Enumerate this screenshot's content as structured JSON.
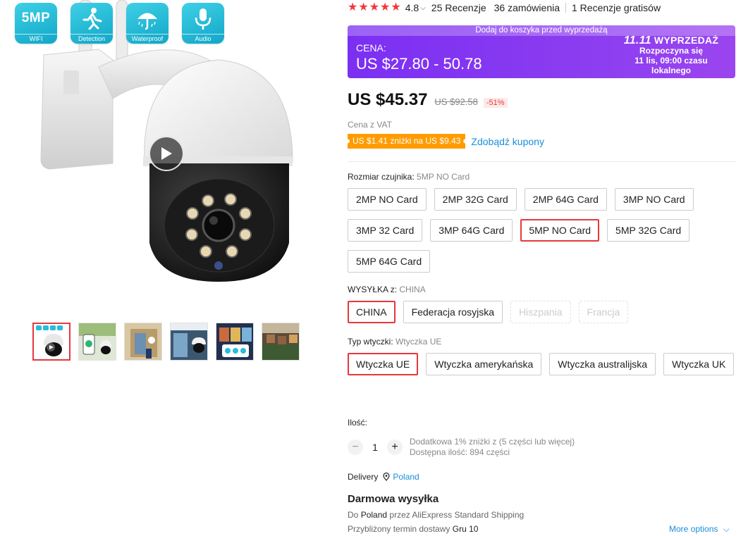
{
  "gallery": {
    "badges": [
      {
        "big": "5MP",
        "label": "WIFI"
      },
      {
        "icon": "running-person-icon",
        "label": "Detection"
      },
      {
        "icon": "umbrella-rain-icon",
        "label": "Waterproof"
      },
      {
        "icon": "microphone-icon",
        "label": "Audio"
      }
    ],
    "thumbnail_count": 6,
    "active_thumbnail": 1
  },
  "rating": {
    "stars": 5,
    "score": "4.8",
    "reviews": "25 Recenzje",
    "orders": "36 zamówienia",
    "gift_reviews": "1 Recenzje gratisów"
  },
  "promo": {
    "topbar": "Dodaj do koszyka przed wyprzedażą",
    "price_label": "CENA:",
    "price_range": "US $27.80 - 50.78",
    "sale_prefix": "11.11",
    "sale_title": "WYPRZEDAŻ",
    "sale_line1": "Rozpoczyna się",
    "sale_line2": "11 lis, 09:00 czasu",
    "sale_line3": "lokalnego"
  },
  "price": {
    "current": "US $45.37",
    "original": "US $92.58",
    "discount": "-51%",
    "vat_note": "Cena z VAT"
  },
  "coupon": {
    "tag": "US $1.41 zniżki na US $9.43",
    "link": "Zdobądź kupony"
  },
  "sensor": {
    "label": "Rozmiar czujnika:",
    "selected": "5MP NO Card",
    "options": [
      "2MP NO Card",
      "2MP 32G Card",
      "2MP 64G Card",
      "3MP NO Card",
      "3MP 32 Card",
      "3MP 64G Card",
      "5MP NO Card",
      "5MP 32G Card",
      "5MP 64G Card"
    ]
  },
  "shipping_from": {
    "label": "WYSYŁKA z:",
    "selected": "CHINA",
    "options": [
      "CHINA",
      "Federacja rosyjska",
      "Hiszpania",
      "Francja"
    ]
  },
  "plug": {
    "label": "Typ wtyczki:",
    "selected": "Wtyczka UE",
    "options": [
      "Wtyczka UE",
      "Wtyczka amerykańska",
      "Wtyczka australijska",
      "Wtyczka UK"
    ]
  },
  "quantity": {
    "label": "Ilość:",
    "minus": "−",
    "value": "1",
    "plus": "+",
    "note1": "Dodatkowa 1% zniżki z (5 części lub więcej)",
    "note2": "Dostępna ilość: 894 części"
  },
  "delivery": {
    "label": "Delivery",
    "location": "Poland"
  },
  "shipping": {
    "title": "Darmowa wysyłka",
    "to_prefix": "Do",
    "to_country": "Poland",
    "method": "przez AliExpress Standard Shipping",
    "eta_prefix": "Przybliżony termin dostawy",
    "eta_value": "Gru 10",
    "more": "More options"
  },
  "colors": {
    "accent_red": "#e4393c",
    "promo_purple": "#8436f1",
    "coupon_orange": "#ff9c00",
    "link_blue": "#1a8ed8",
    "badge_teal": "#1fb8d6"
  }
}
